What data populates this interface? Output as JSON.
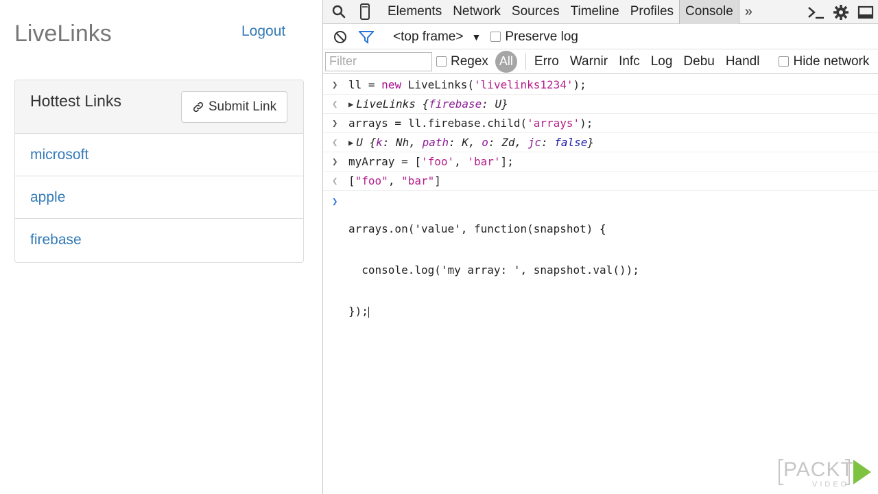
{
  "app": {
    "brand": "LiveLinks",
    "logout": "Logout",
    "panel": {
      "title": "Hottest Links",
      "submit_label": "Submit Link",
      "links": [
        "microsoft",
        "apple",
        "firebase"
      ]
    }
  },
  "devtools": {
    "tabs": [
      "Elements",
      "Network",
      "Sources",
      "Timeline",
      "Profiles",
      "Console"
    ],
    "active_tab": "Console",
    "more": "»",
    "frame": "<top frame>",
    "preserve_log": "Preserve log",
    "filter_placeholder": "Filter",
    "regex": "Regex",
    "levels": [
      "All",
      "Errors",
      "Warnings",
      "Info",
      "Logs",
      "Debug",
      "Handled"
    ],
    "level_display": [
      "All",
      "Erro",
      "Warnir",
      "Infc",
      "Log",
      "Debu",
      "Handl"
    ],
    "hide_network": "Hide network",
    "console": {
      "l1_pre": "ll = ",
      "l1_kw": "new",
      "l1_mid": " LiveLinks(",
      "l1_str": "'livelinks1234'",
      "l1_post": ");",
      "o1_obj": "LiveLinks {",
      "o1_prop": "firebase",
      "o1_val": ": U}",
      "l2_pre": "arrays = ll.firebase.child(",
      "l2_str": "'arrays'",
      "l2_post": ");",
      "o2_obj": "U {",
      "o2_p1": "k",
      "o2_v1": ": Nh, ",
      "o2_p2": "path",
      "o2_v2": ": K, ",
      "o2_p3": "o",
      "o2_v3": ": Zd, ",
      "o2_p4": "jc",
      "o2_v4": ": ",
      "o2_false": "false",
      "o2_end": "}",
      "l3_pre": "myArray = [",
      "l3_s1": "'foo'",
      "l3_mid": ", ",
      "l3_s2": "'bar'",
      "l3_post": "];",
      "o3_pre": "[",
      "o3_s1": "\"foo\"",
      "o3_mid": ", ",
      "o3_s2": "\"bar\"",
      "o3_post": "]",
      "input_lines": [
        "arrays.on('value', function(snapshot) {",
        "  console.log('my array: ', snapshot.val());",
        "});"
      ]
    }
  },
  "watermark": {
    "brand": "PACKT",
    "sub": "VIDEO"
  }
}
